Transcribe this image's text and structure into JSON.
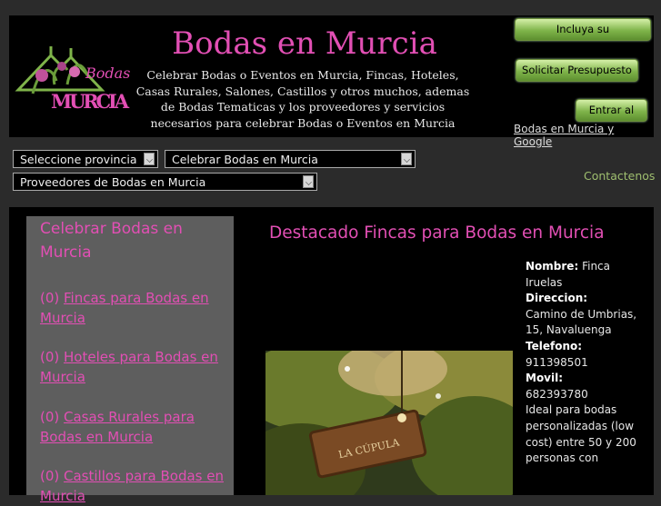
{
  "header": {
    "title": "Bodas en Murcia",
    "logo_text_top": "Bodas",
    "logo_text_bottom": "MURCIA",
    "description": "Celebrar Bodas o Eventos en Murcia, Fincas, Hoteles, Casas Rurales, Salones, Castillos y otros muchos, ademas de Bodas Tematicas y los proveedores y servicios necesarios para celebrar Bodas o Eventos en Murcia",
    "buttons": {
      "incluya": "Incluya su establecimiento",
      "presupuesto": "Solicitar Presupuesto",
      "foro": "Entrar al Foro"
    },
    "google_link": "Bodas en Murcia y Google"
  },
  "selects": {
    "provincia": "Seleccione provincia",
    "celebrar": "Celebrar Bodas en Murcia",
    "proveedores": "Proveedores de Bodas en Murcia"
  },
  "contact": "Contactenos",
  "sidebar": {
    "title": "Celebrar Bodas en Murcia",
    "items": [
      {
        "count": "(0) ",
        "label": "Fincas para Bodas en Murcia"
      },
      {
        "count": "(0) ",
        "label": "Hoteles para Bodas en Murcia"
      },
      {
        "count": "(0) ",
        "label": "Casas Rurales para Bodas en Murcia"
      },
      {
        "count": "(0) ",
        "label": "Castillos para Bodas en Murcia"
      }
    ]
  },
  "featured": {
    "title": "Destacado Fincas para Bodas en Murcia",
    "photo_sign": "LA CÚPULA",
    "nombre_label": "Nombre:",
    "nombre": "Finca Iruelas",
    "direccion_label": "Direccion:",
    "direccion": "Camino de Umbrias, 15, Navaluenga",
    "telefono_label": "Telefono:",
    "telefono": "911398501",
    "movil_label": "Movil:",
    "movil": "682393780",
    "descripcion": "Ideal para bodas personalizadas (low cost) entre 50 y 200 personas con"
  },
  "colors": {
    "accent": "#e24fb4",
    "button_green": "#7fb44a",
    "background": "#2b2b2b"
  }
}
